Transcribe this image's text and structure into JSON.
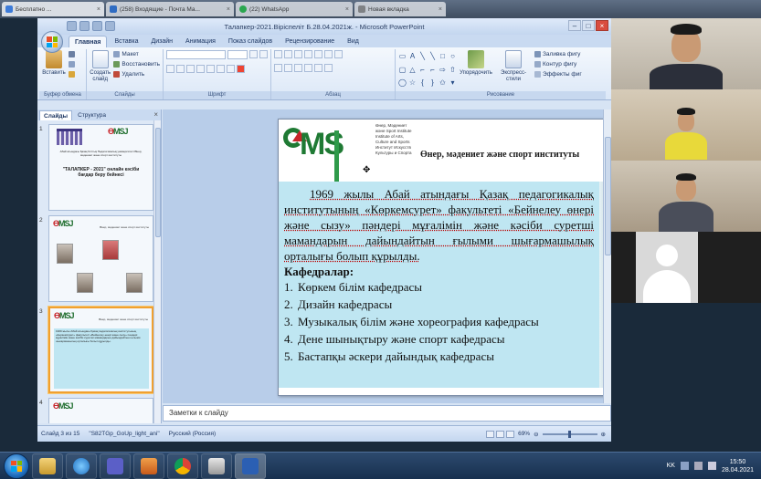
{
  "browser_tabs": [
    {
      "label": "Бесплатно ..."
    },
    {
      "label": "(258) Входящие - Почта Ma..."
    },
    {
      "label": "(22) WhatsApp"
    },
    {
      "label": "Новая вкладка"
    }
  ],
  "window": {
    "title": "Талапкер-2021.Віріспеліт Б.28.04.2021ж. - Microsoft PowerPoint"
  },
  "ribbon": {
    "tabs": [
      "Главная",
      "Вставка",
      "Дизайн",
      "Анимация",
      "Показ слайдов",
      "Рецензирование",
      "Вид"
    ],
    "active_tab": "Главная",
    "paste": "Вставить",
    "new_slide": "Создать слайд",
    "layout": "Макет",
    "reset": "Восстановить",
    "delete": "Удалить",
    "arrange": "Упорядочить",
    "quick_styles": "Экспресс-стили",
    "shape_fill": "Заливка фигу",
    "shape_outline": "Контур фигу",
    "shape_effects": "Эффекты фиг",
    "groups": {
      "clipboard": "Буфер обмена",
      "slides": "Слайды",
      "font": "Шрифт",
      "paragraph": "Абзац",
      "drawing": "Рисование"
    }
  },
  "left_pane": {
    "tabs": [
      "Слайды",
      "Структура"
    ],
    "slide_numbers": [
      "1",
      "2",
      "3",
      "4"
    ],
    "thumb1": {
      "header": "Абай атындағы Қазақ Ұлттық Педагогикалық университеті Өнер, мәдениет және спорт институты",
      "title": "\"ТАЛАПКЕР - 2021\" онлайн кәсіби бағдар беру бейнесі"
    },
    "thumb2": {
      "header": "Өнер, мәдениет және спорт институты"
    },
    "thumb3": {
      "header": "Өнер, мәдениет және спорт институты"
    }
  },
  "slide": {
    "logo_text": "ӨМSJ",
    "logo_lines": [
      "Өнер, Мәдениет",
      "және Sport Institute",
      "Institute of Arts,",
      "Culture and Sports",
      "Институт Искусств",
      "Культуры и Спорта"
    ],
    "institute_name": "Өнер, мәдениет және спорт институты",
    "intro": "1969 жылы Абай атындағы Қазақ педагогикалық институтының «Көркемсурет» факультеті «Бейнелеу өнері және сызу» пәндері мұғалімін және кәсіби суретші мамандарын дайындайтын ғылыми шығармашылық орталығы болып құрылды.",
    "departments_heading": "Кафедралар:",
    "departments": [
      {
        "n": "1.",
        "name": "Көркем білім кафедрасы"
      },
      {
        "n": "2.",
        "name": "Дизайн кафедрасы"
      },
      {
        "n": "3.",
        "name": "Музыкалық білім және хореография кафедрасы"
      },
      {
        "n": "4.",
        "name": "Дене шынықтыру және спорт кафедрасы"
      },
      {
        "n": "5.",
        "name": "Бастапқы әскери дайындық кафедрасы"
      }
    ]
  },
  "notes": {
    "placeholder": "Заметки к слайду"
  },
  "status": {
    "slide_pos": "Слайд 3 из 15",
    "theme": "\"S82TGp_GoUp_light_ani\"",
    "language": "Русский (Россия)",
    "zoom": "69%"
  },
  "tray": {
    "lang": "KK",
    "time": "15:50",
    "date": "28.04.2021"
  }
}
